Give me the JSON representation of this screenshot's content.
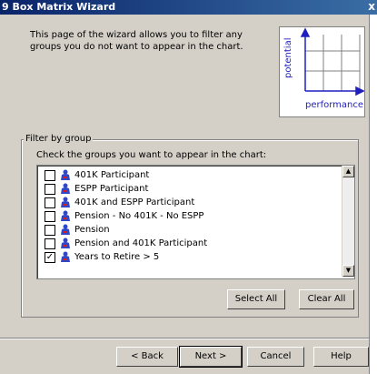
{
  "window": {
    "title": "9 Box Matrix Wizard",
    "close_glyph": "x"
  },
  "intro": {
    "text": "This page of the wizard allows you to filter any groups you do not want to appear in the chart."
  },
  "matrix": {
    "y_label": "potential",
    "x_label": "performance",
    "accent": "#1f1fbf"
  },
  "filter": {
    "legend": "Filter by group",
    "instruction": "Check the groups you want to appear in the chart:",
    "groups": [
      {
        "label": "401K Participant",
        "checked": false
      },
      {
        "label": "ESPP Participant",
        "checked": false
      },
      {
        "label": "401K and ESPP Participant",
        "checked": false
      },
      {
        "label": "Pension - No 401K - No ESPP",
        "checked": false
      },
      {
        "label": "Pension",
        "checked": false
      },
      {
        "label": "Pension and 401K Participant",
        "checked": false
      },
      {
        "label": "Years to Retire > 5",
        "checked": true
      }
    ],
    "select_all": "Select All",
    "clear_all": "Clear All"
  },
  "nav": {
    "back": "< Back",
    "next": "Next >",
    "cancel": "Cancel",
    "help": "Help"
  }
}
